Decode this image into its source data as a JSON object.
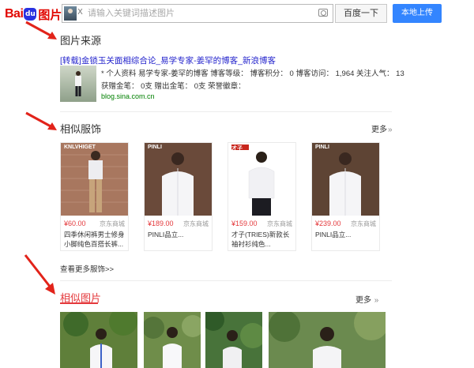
{
  "header": {
    "logo_bai": "Bai",
    "logo_du": "du",
    "logo_tupian": "图片",
    "thumb_close": "X",
    "search_placeholder": "请输入关键词描述图片",
    "baidu_button": "百度一下",
    "upload_button": "本地上传"
  },
  "source": {
    "title": "图片来源",
    "link": "[转载]金锁玉关面相综合论_易学专家-姜罕的博客_新浪博客",
    "meta_line1": "* 个人资料 易学专家-姜罕的博客 博客等级： 博客积分： 0 博客访问： 1,964 关注人气： 13",
    "meta_line2": "获赠金笔： 0支 赠出金笔： 0支 荣誉徽章：",
    "domain": "blog.sina.com.cn"
  },
  "similar_clothing": {
    "title": "相似服饰",
    "more": "更多",
    "view_more": "查看更多服饰>>",
    "items": [
      {
        "brand": "KNLVHIGET",
        "price": "¥60.00",
        "shop": "京东商城",
        "title": "四季休闲裤男士修身小脚纯色百搭长裤..."
      },
      {
        "brand": "PINLI",
        "price": "¥189.00",
        "shop": "京东商城",
        "title": "PINLI品立..."
      },
      {
        "brand": "才子",
        "price": "¥159.00",
        "shop": "京东商城",
        "title": "才子(TRIES)新款长袖衬衫纯色..."
      },
      {
        "brand": "PINLI",
        "price": "¥239.00",
        "shop": "京东商城",
        "title": "PINLI品立..."
      }
    ]
  },
  "similar_images": {
    "title": "相似图片",
    "more": "更多"
  },
  "colors": {
    "brand_red": "#e10601",
    "link_blue": "#2222cc",
    "price_red": "#e4393c",
    "upload_blue": "#3385ff",
    "domain_green": "#008000"
  }
}
